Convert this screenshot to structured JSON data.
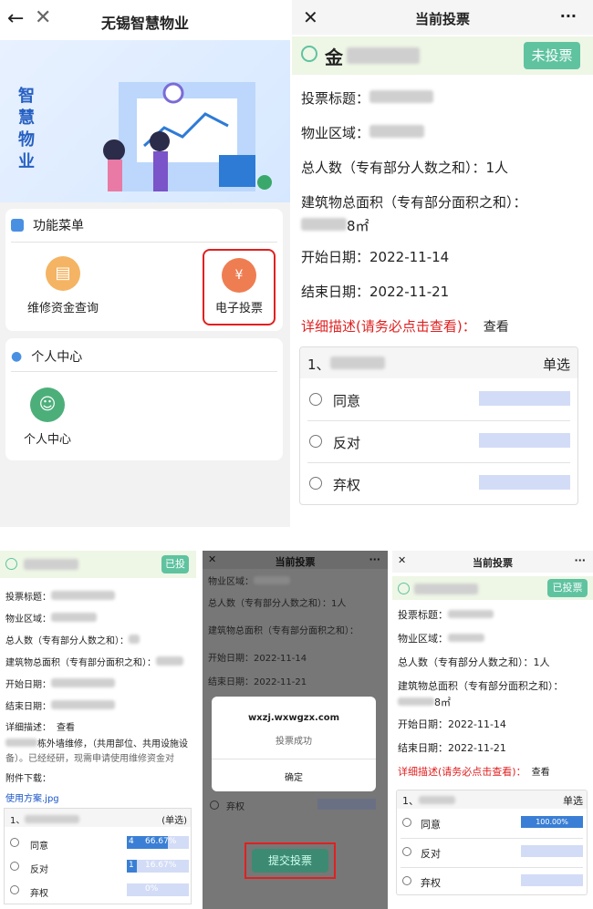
{
  "panel1": {
    "title": "无锡智慧物业",
    "back_icon": "arrow-left-icon",
    "close_icon": "close-icon",
    "banner_text": "智慧物业",
    "menu_title": "功能菜单",
    "menu_items": [
      {
        "label": "维修资金查询",
        "icon": "clipboard-icon",
        "color": "#f4b463"
      },
      {
        "label": "电子投票",
        "icon": "money-bag-icon",
        "color": "#ef7d52"
      }
    ],
    "personal_title": "个人中心",
    "personal_items": [
      {
        "label": "个人中心",
        "icon": "user-avatar-icon",
        "color": "#4caf7a"
      }
    ]
  },
  "panel2": {
    "title": "当前投票",
    "more": "···",
    "vote_name_prefix": "金",
    "status_button": "未投票",
    "fields": {
      "title_label": "投票标题：",
      "area_label": "物业区域：",
      "people_label": "总人数（专有部分人数之和）：",
      "people_value": "1人",
      "building_label": "建筑物总面积（专有部分面积之和）：",
      "building_value_suffix": "8㎡",
      "start_label": "开始日期：",
      "start_value": "2022-11-14",
      "end_label": "结束日期：",
      "end_value": "2022-11-21",
      "detail_label": "详细描述(请务必点击查看)：",
      "detail_link": "查看"
    },
    "question_prefix": "1、",
    "question_type": "单选",
    "options": [
      "同意",
      "反对",
      "弃权"
    ]
  },
  "panel3": {
    "status_button": "已投",
    "fields": {
      "title_label": "投票标题：",
      "area_label": "物业区域：",
      "people_label": "总人数（专有部分人数之和）：",
      "building_label": "建筑物总面积（专有部分面积之和）：",
      "start_label": "开始日期：",
      "end_label": "结束日期：",
      "detail_label": "详细描述：",
      "detail_link": "查看"
    },
    "desc_line1": "栋外墙维修，（共用部位、共用设施设",
    "desc_line2": "备）。已经经研，现需申请使用维修资金对",
    "attachment_label": "附件下载：",
    "attachment_file": "使用方案.jpg",
    "question_prefix": "1、",
    "question_type": "(单选)",
    "options": [
      {
        "label": "同意",
        "count": "4",
        "percent": "66.67%",
        "fill": 0.6667
      },
      {
        "label": "反对",
        "count": "1",
        "percent": "16.67%",
        "fill": 0.1667
      },
      {
        "label": "弃权",
        "count": "",
        "percent": "0%",
        "fill": 0
      }
    ]
  },
  "panel4": {
    "title": "当前投票",
    "more": "···",
    "area_label": "物业区域：",
    "people_label": "总人数（专有部分人数之和）：",
    "people_value": "1人",
    "building_label": "建筑物总面积（专有部分面积之和）：",
    "start_label": "开始日期：",
    "start_value": "2022-11-14",
    "end_label": "结束日期：",
    "end_value": "2022-11-21",
    "dialog_host": "wxzj.wxwgzx.com",
    "dialog_message": "投票成功",
    "dialog_confirm": "确定",
    "option_abstain": "弃权",
    "submit_button": "提交投票"
  },
  "panel5": {
    "title": "当前投票",
    "more": "···",
    "status_button": "已投票",
    "fields": {
      "title_label": "投票标题：",
      "area_label": "物业区域：",
      "people_label": "总人数（专有部分人数之和）：",
      "people_value": "1人",
      "building_label": "建筑物总面积（专有部分面积之和）：",
      "building_value_suffix": "8㎡",
      "start_label": "开始日期：",
      "start_value": "2022-11-14",
      "end_label": "结束日期：",
      "end_value": "2022-11-21",
      "detail_label": "详细描述(请务必点击查看)：",
      "detail_link": "查看"
    },
    "question_prefix": "1、",
    "question_type": "单选",
    "options": [
      {
        "label": "同意",
        "percent": "100.00%"
      },
      {
        "label": "反对",
        "percent": ""
      },
      {
        "label": "弃权",
        "percent": ""
      }
    ]
  },
  "colors": {
    "accent_green": "#5fc3a0",
    "highlight_red": "#e02020",
    "bar_blue": "#3a7fd5",
    "bar_light": "#d3dcf6"
  }
}
